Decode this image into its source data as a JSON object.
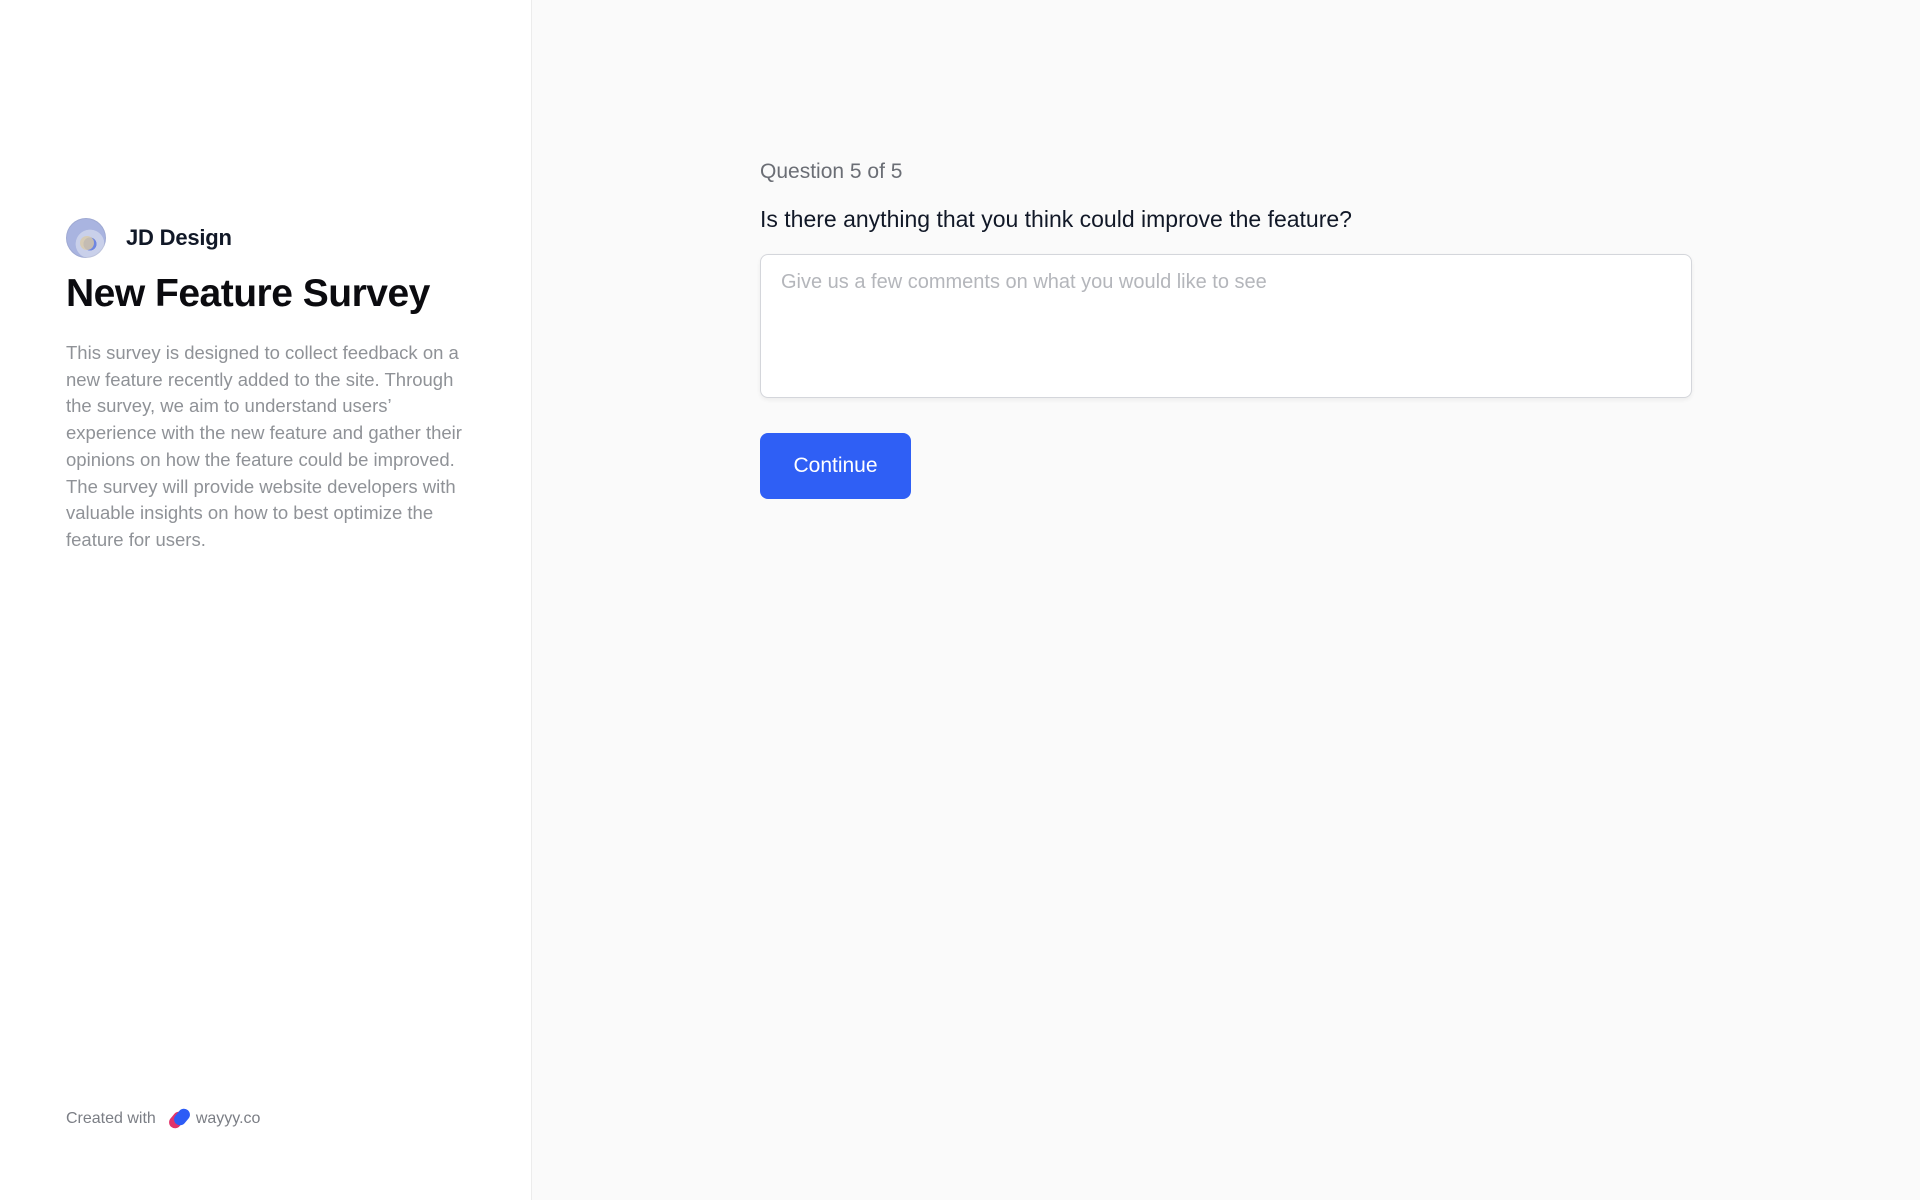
{
  "sidebar": {
    "brand_name": "JD Design",
    "survey_title": "New Feature Survey",
    "survey_description": "This survey is designed to collect feedback on a new feature recently added to the site. Through the survey, we aim to understand users’ experience with the new feature and gather their opinions on how the feature could be improved. The survey will provide website developers with valuable insights on how to best optimize the feature for users.",
    "footer": {
      "created_with_label": "Created with",
      "site_name": "wayyy.co",
      "logo_icon": "wayyy-logo-icon"
    }
  },
  "main": {
    "question_counter": "Question 5 of 5",
    "question_text": "Is there anything that you think could improve the feature?",
    "answer_value": "",
    "answer_placeholder": "Give us a few comments on what you would like to see",
    "continue_label": "Continue"
  },
  "colors": {
    "accent": "#2f5ff5",
    "sidebar_bg": "#ffffff",
    "main_bg": "#fafafa",
    "logo_pink": "#e2336b",
    "logo_blue": "#2d5cf6"
  }
}
